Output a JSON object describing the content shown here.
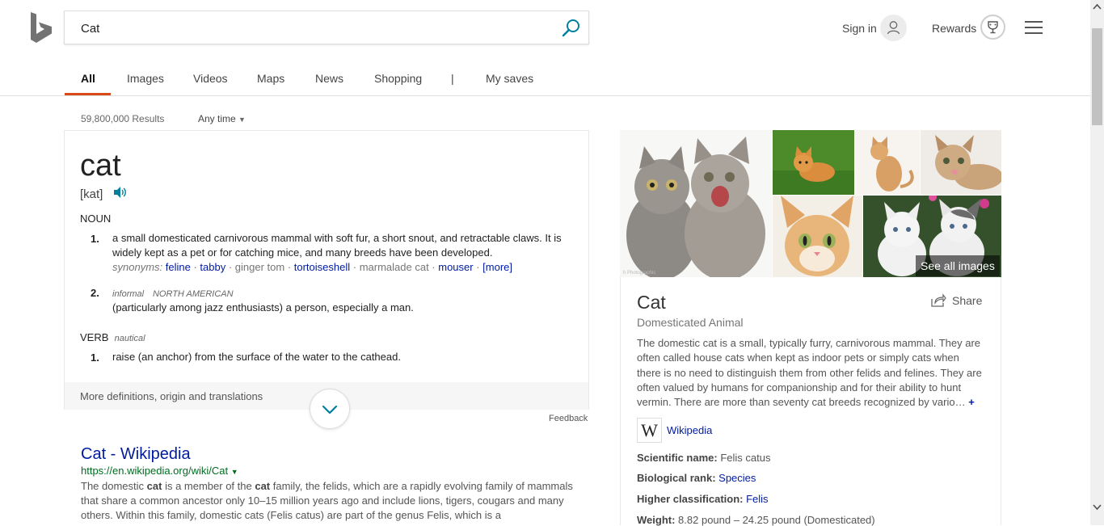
{
  "search": {
    "query": "Cat"
  },
  "header": {
    "sign_in": "Sign in",
    "rewards": "Rewards"
  },
  "nav": {
    "tabs": [
      "All",
      "Images",
      "Videos",
      "Maps",
      "News",
      "Shopping",
      "|",
      "My saves"
    ]
  },
  "results": {
    "count": "59,800,000 Results",
    "filter": "Any time"
  },
  "dictionary": {
    "word": "cat",
    "pronunciation": "[kat]",
    "noun_label": "NOUN",
    "def1_num": "1.",
    "def1": "a small domesticated carnivorous mammal with soft fur, a short snout, and retractable claws. It is widely kept as a pet or for catching mice, and many breeds have been developed.",
    "synonyms_label": "synonyms:",
    "synonyms": [
      "feline",
      "tabby",
      "ginger tom",
      "tortoiseshell",
      "marmalade cat",
      "mouser",
      "[more]"
    ],
    "def2_num": "2.",
    "def2_label_1": "informal",
    "def2_label_2": "NORTH AMERICAN",
    "def2": "(particularly among jazz enthusiasts) a person, especially a man.",
    "verb_label": "VERB",
    "verb_qualifier": "nautical",
    "verb_def_num": "1.",
    "verb_def": "raise (an anchor) from the surface of the water to the cathead.",
    "more": "More definitions, origin and translations",
    "feedback": "Feedback"
  },
  "wiki_result": {
    "title": "Cat - Wikipedia",
    "url": "https://en.wikipedia.org/wiki/Cat",
    "snippet_1": "The domestic ",
    "snippet_b1": "cat",
    "snippet_2": " is a member of the ",
    "snippet_b2": "cat",
    "snippet_3": " family, the felids, which are a rapidly evolving family of mammals that share a common ancestor only 10–15 million years ago and include lions, tigers, cougars and many others. Within this family, domestic cats (Felis catus) are part of the genus Felis, which is a"
  },
  "images": {
    "see_all": "See all images",
    "watermark": "h Photographic"
  },
  "entity": {
    "title": "Cat",
    "subtitle": "Domesticated Animal",
    "share": "Share",
    "description": "The domestic cat is a small, typically furry, carnivorous mammal. They are often called house cats when kept as indoor pets or simply cats when there is no need to distinguish them from other felids and felines. They are often valued by humans for companionship and for their ability to hunt vermin. There are more than seventy cat breeds recognized by vario…",
    "more_symbol": "+",
    "source_logo": "W",
    "source": "Wikipedia",
    "facts": [
      {
        "label": "Scientific name:",
        "value": "Felis catus"
      },
      {
        "label": "Biological rank:",
        "value": "Species"
      },
      {
        "label": "Higher classification:",
        "value": "Felis"
      },
      {
        "label": "Weight:",
        "value": "8.82 pound – 24.25 pound (Domesticated)"
      }
    ]
  },
  "colors": {
    "accent": "#d94817",
    "link": "#001ba0",
    "url_green": "#006d21",
    "bing_teal": "#00809d"
  }
}
